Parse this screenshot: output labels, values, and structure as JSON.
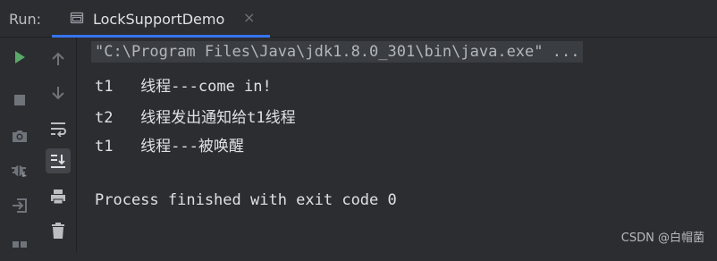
{
  "run_panel": {
    "label": "Run:",
    "tab_title": "LockSupportDemo",
    "tab_close": "×",
    "accent": "#3574f0"
  },
  "left_toolbar": {
    "icons": [
      "run-icon",
      "stop-icon",
      "camera-icon",
      "debug-icon",
      "exit-icon",
      "layout-icon"
    ]
  },
  "side_toolbar": {
    "icons": [
      "arrow-up-icon",
      "arrow-down-icon",
      "soft-wrap-icon",
      "scroll-to-end-icon",
      "print-icon",
      "trash-icon"
    ]
  },
  "console": {
    "command_line": "\"C:\\Program Files\\Java\\jdk1.8.0_301\\bin\\java.exe\" ...",
    "lines": [
      "t1   线程---come in!",
      "t2   线程发出通知给t1线程",
      "t1   线程---被唤醒"
    ],
    "exit_message": "Process finished with exit code 0"
  },
  "watermark": "CSDN @白帽菌"
}
